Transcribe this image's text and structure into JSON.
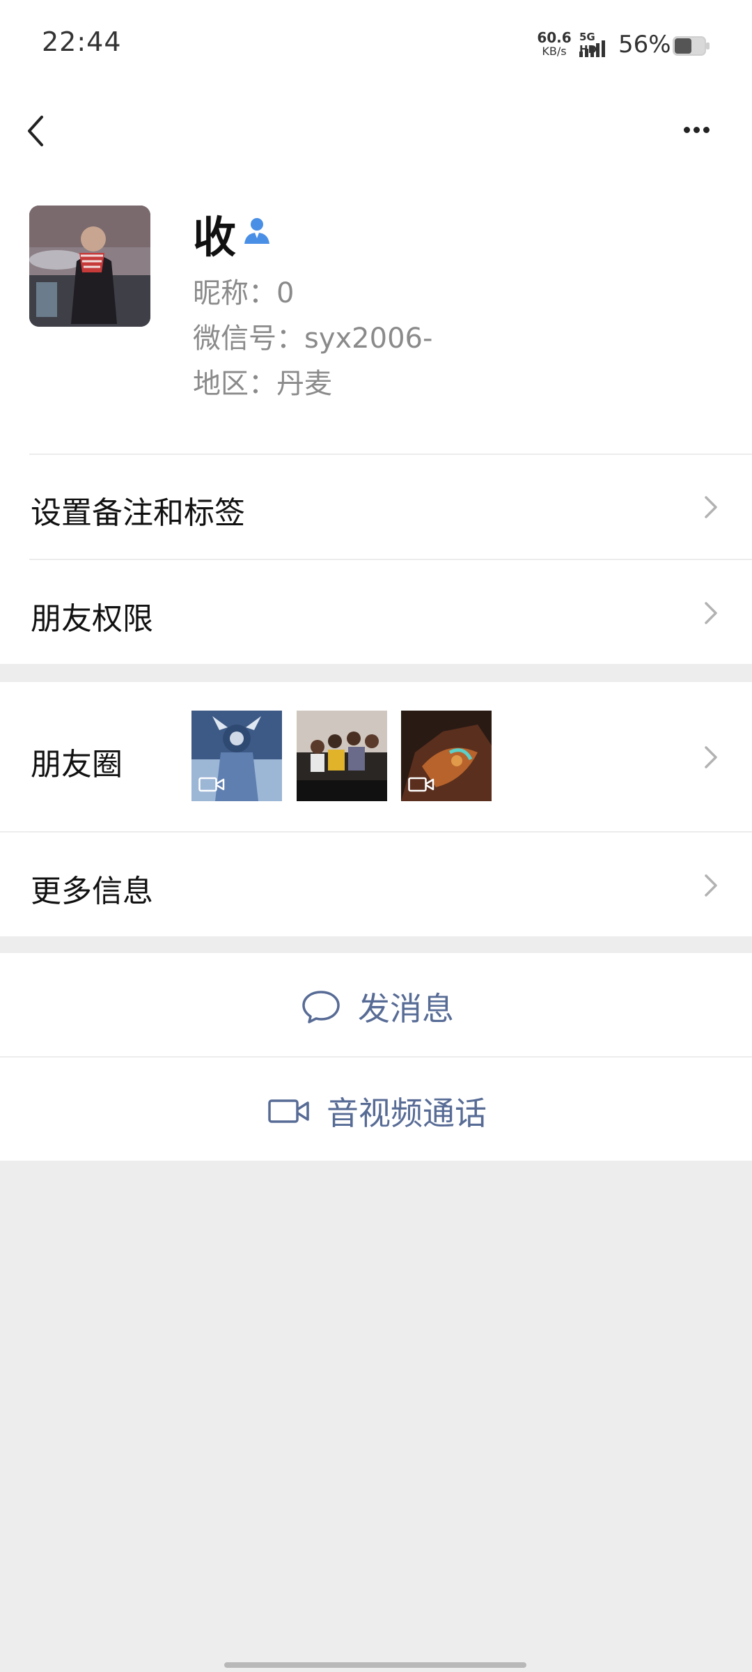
{
  "status_bar": {
    "time": "22:44",
    "net_speed_value": "60.6",
    "net_speed_unit": "KB/s",
    "network_tag": "5G HD",
    "battery_percent": "56%",
    "battery_level": 0.56
  },
  "nav": {
    "back_icon": "chevron-left-icon",
    "more_icon": "more-dots-icon"
  },
  "profile": {
    "name": "收",
    "nickname": "昵称：0",
    "wechat_id": "微信号：syx2006-",
    "region": "地区：丹麦"
  },
  "rows": {
    "remark_label": "设置备注和标签",
    "permissions_label": "朋友权限",
    "moments_label": "朋友圈",
    "more_info_label": "更多信息"
  },
  "actions": {
    "message_label": "发消息",
    "call_label": "音视频通话"
  },
  "colors": {
    "accent_blue": "#576b95",
    "verify_blue": "#4a8fe6",
    "background": "#ededed"
  }
}
